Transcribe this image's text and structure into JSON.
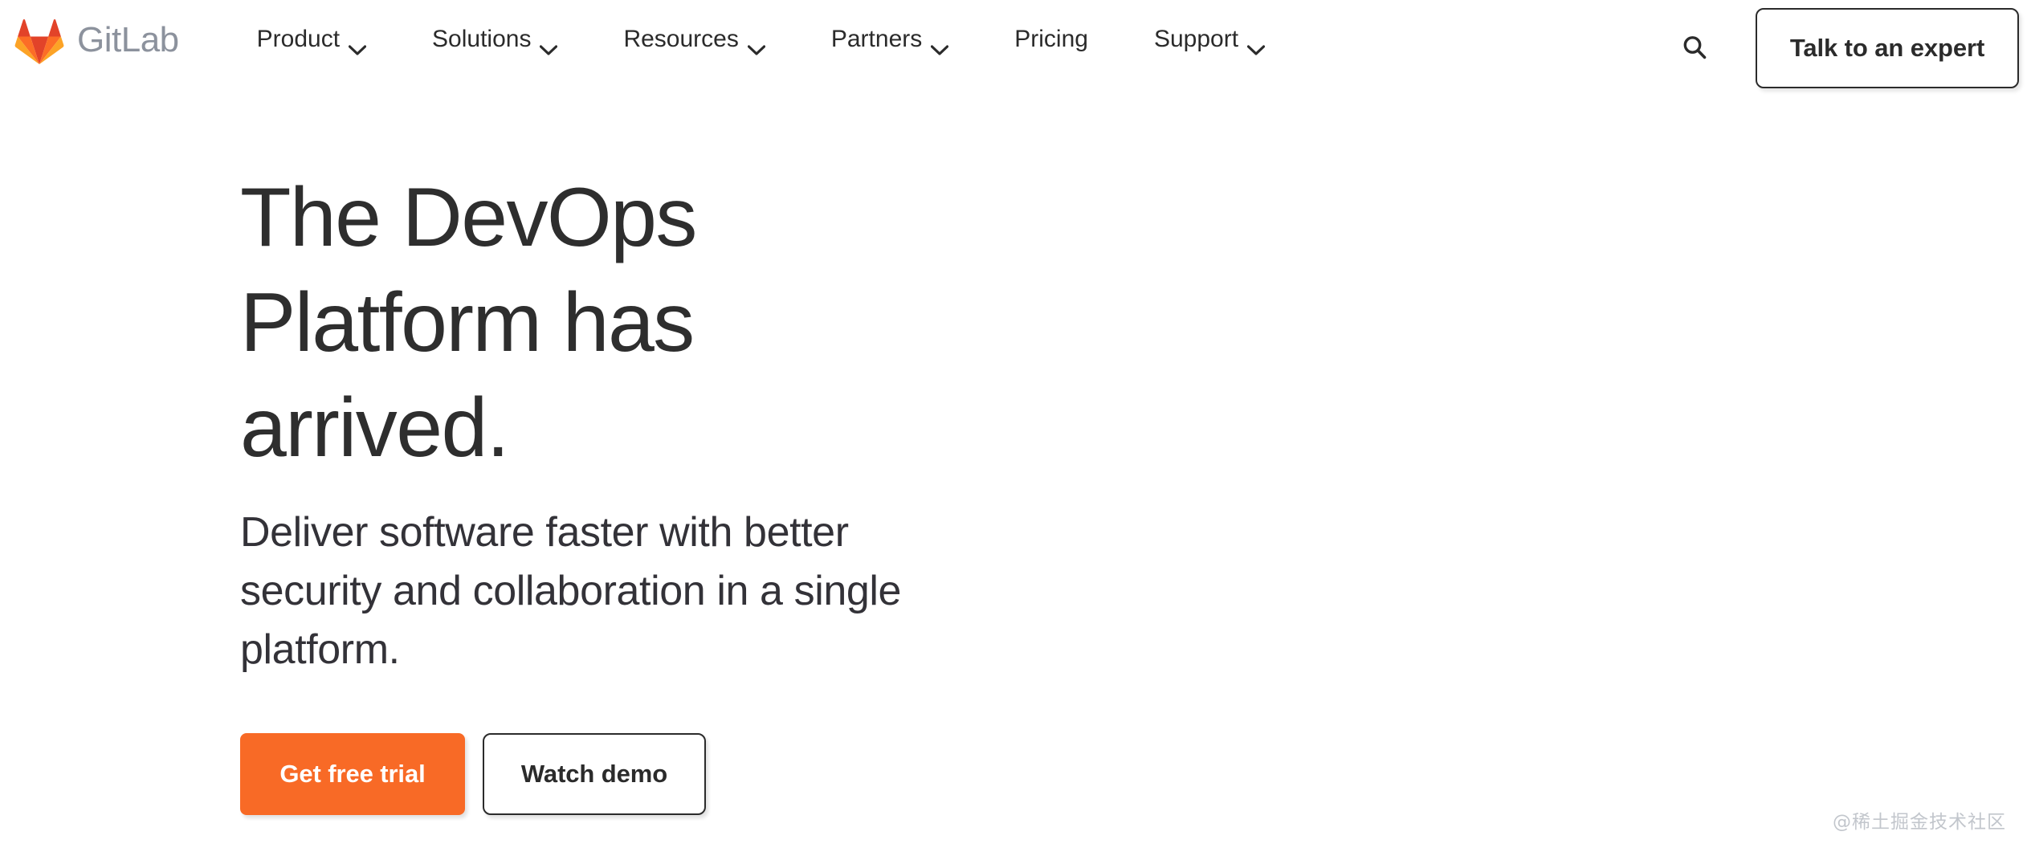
{
  "header": {
    "brand": {
      "logo_icon": "gitlab-tanuki-icon",
      "wordmark": "GitLab",
      "wordmark_color": "#8C929D",
      "logo_colors": {
        "dark_orange": "#E24329",
        "mid_orange": "#FC6D26",
        "light_orange": "#FCA326"
      }
    },
    "nav": [
      {
        "label": "Product",
        "has_dropdown": true,
        "icon": "chevron-down-icon"
      },
      {
        "label": "Solutions",
        "has_dropdown": true,
        "icon": "chevron-down-icon"
      },
      {
        "label": "Resources",
        "has_dropdown": true,
        "icon": "chevron-down-icon"
      },
      {
        "label": "Partners",
        "has_dropdown": true,
        "icon": "chevron-down-icon"
      },
      {
        "label": "Pricing",
        "has_dropdown": false,
        "icon": ""
      },
      {
        "label": "Support",
        "has_dropdown": true,
        "icon": "chevron-down-icon"
      }
    ],
    "search": {
      "icon": "search-icon",
      "label": "Search"
    },
    "cta": {
      "label": "Talk to an expert"
    }
  },
  "hero": {
    "title": "The DevOps Platform has arrived.",
    "subtitle": "Deliver software faster with better security and collaboration in a single platform.",
    "buttons": {
      "primary": {
        "label": "Get free trial",
        "bg_color": "#F86A26",
        "text_color": "#FFFFFF"
      },
      "secondary": {
        "label": "Watch demo",
        "bg_color": "#FFFFFF",
        "text_color": "#2B2B2B"
      }
    }
  },
  "watermark": {
    "text": "@稀土掘金技术社区"
  }
}
